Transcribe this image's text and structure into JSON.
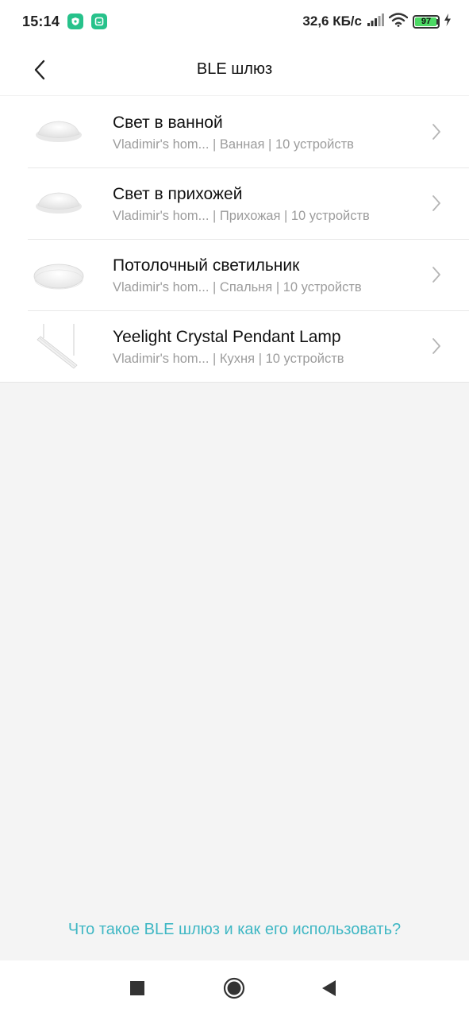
{
  "status_bar": {
    "time": "15:14",
    "net_speed": "32,6 КБ/с",
    "battery_level": "97",
    "battery_fraction": 0.97,
    "icons": [
      "shield-app-icon",
      "mi-home-app-icon",
      "signal-icon",
      "wifi-icon",
      "battery-icon",
      "charging-icon"
    ]
  },
  "header": {
    "title": "BLE шлюз",
    "back_icon": "chevron-left-icon"
  },
  "devices": [
    {
      "name": "Свет в ванной",
      "home": "Vladimir's hom...",
      "room": "Ванная",
      "count": "10 устройств",
      "thumb": "ceiling-lamp-domed"
    },
    {
      "name": "Свет в прихожей",
      "home": "Vladimir's hom...",
      "room": "Прихожая",
      "count": "10 устройств",
      "thumb": "ceiling-lamp-domed"
    },
    {
      "name": "Потолочный светильник",
      "home": "Vladimir's hom...",
      "room": "Спальня",
      "count": "10 устройств",
      "thumb": "ceiling-lamp-flat"
    },
    {
      "name": "Yeelight Crystal Pendant Lamp",
      "home": "Vladimir's hom...",
      "room": "Кухня",
      "count": "10 устройств",
      "thumb": "pendant-lamp"
    }
  ],
  "separator": "|",
  "help_link": "Что такое BLE шлюз и как его использовать?",
  "nav_bar": {
    "icons": [
      "recents-square-icon",
      "home-circle-icon",
      "back-triangle-icon"
    ]
  },
  "colors": {
    "accent": "#3fb7c4",
    "badge": "#27c28b",
    "battery": "#4cd964",
    "background": "#f4f4f4"
  }
}
